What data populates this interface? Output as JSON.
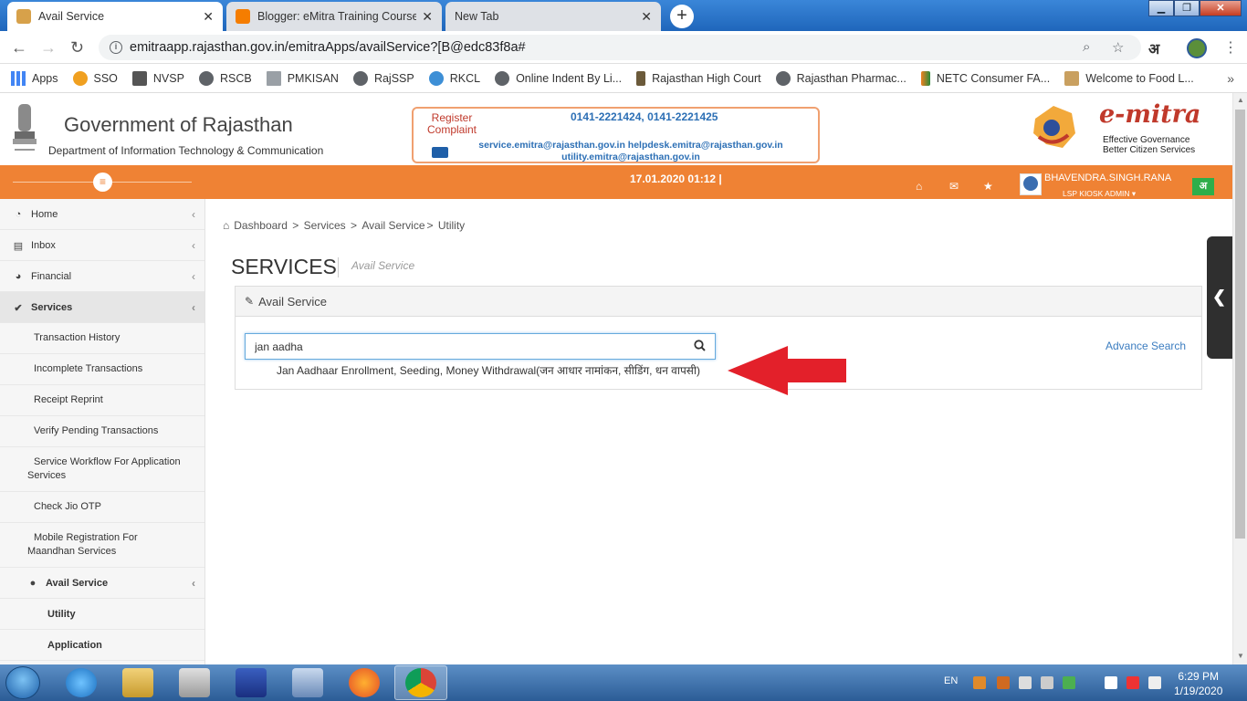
{
  "browser": {
    "tabs": [
      {
        "title": "Avail Service",
        "active": true
      },
      {
        "title": "Blogger: eMitra Training Course - ",
        "active": false
      },
      {
        "title": "New Tab",
        "active": false
      }
    ],
    "new_tab_symbol": "+",
    "url": "emitraapp.rajasthan.gov.in/emitraApps/availService?[B@edc83f8a#",
    "hindi_button": "अ",
    "bookmarks": [
      "Apps",
      "SSO",
      "NVSP",
      "RSCB",
      "PMKISAN",
      "RajSSP",
      "RKCL",
      "Online Indent By Li...",
      "Rajasthan High Court",
      "Rajasthan Pharmac...",
      "NETC Consumer FA...",
      "Welcome to Food L..."
    ]
  },
  "header": {
    "gov_title": "Government of Rajasthan",
    "department": "Department of Information Technology & Communication",
    "register_complaint": "Register Complaint",
    "phones": "0141-2221424, 0141-2221425",
    "emails_line1": "service.emitra@rajasthan.gov.in helpdesk.emitra@rajasthan.gov.in",
    "emails_line2": "utility.emitra@rajasthan.gov.in",
    "emitra_word": "e-mitra",
    "tagline1": "Effective Governance",
    "tagline2": "Better Citizen Services"
  },
  "topbar": {
    "datetime": "17.01.2020 01:12 |",
    "username": "BHAVENDRA.SINGH.RANA",
    "role": "LSP KIOSK ADMIN ▾",
    "lang": "अ"
  },
  "sidebar": {
    "items": [
      {
        "label": "Home",
        "icon": "dashboard-icon"
      },
      {
        "label": "Inbox",
        "icon": "inbox-icon"
      },
      {
        "label": "Financial",
        "icon": "pie-chart-icon"
      },
      {
        "label": "Services",
        "icon": "check-circle-icon"
      }
    ],
    "service_subs": [
      "Transaction History",
      "Incomplete Transactions",
      "Receipt Reprint",
      "Verify Pending Transactions",
      "Service Workflow For Application Services",
      "Check Jio OTP",
      "Mobile Registration For Maandhan Services"
    ],
    "avail_service": "Avail Service",
    "avail_subs": [
      "Utility",
      "Application"
    ]
  },
  "main": {
    "breadcrumb": [
      "Dashboard",
      "Services",
      "Avail Service",
      "Utility"
    ],
    "title": "SERVICES",
    "subtitle": "Avail Service",
    "panel_title": "Avail Service",
    "search_value": "jan aadha",
    "suggestion": "Jan Aadhaar Enrollment, Seeding, Money Withdrawal(जन आधार नामांकन, सीडिंग, धन वापसी)",
    "advance_search": "Advance Search"
  },
  "taskbar": {
    "lang": "EN",
    "time": "6:29 PM",
    "date": "1/19/2020"
  },
  "colors": {
    "orange": "#ef8234",
    "link_blue": "#3c7dc0",
    "arrow_red": "#e3202a"
  }
}
